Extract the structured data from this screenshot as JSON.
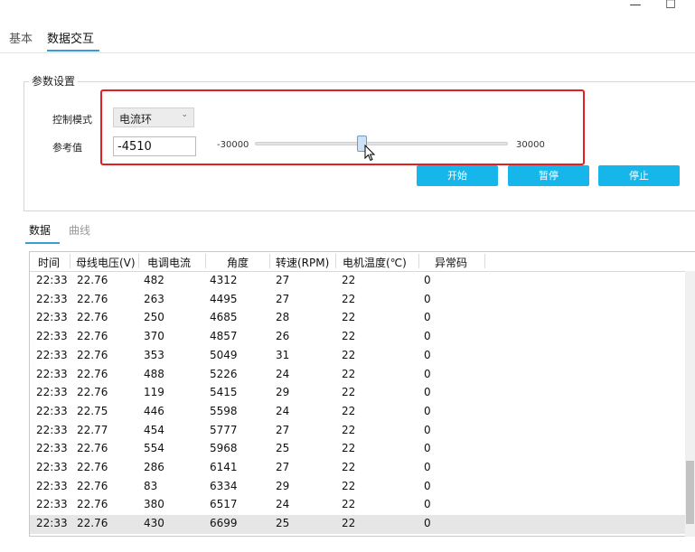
{
  "window": {
    "minimize_icon": "—",
    "maximize_icon": "☐"
  },
  "top_tabs": [
    {
      "label": "基本"
    },
    {
      "label": "数据交互"
    }
  ],
  "params": {
    "title": "参数设置",
    "mode_label": "控制模式",
    "mode_value": "电流环",
    "ref_label": "参考值",
    "ref_value": "-4510",
    "slider_min": "-30000",
    "slider_max": "30000",
    "slider_value": -4510
  },
  "buttons": {
    "start": "开始",
    "pause": "暂停",
    "stop": "停止"
  },
  "data_tabs": [
    {
      "label": "数据"
    },
    {
      "label": "曲线"
    }
  ],
  "table": {
    "columns": [
      "时间",
      "母线电压(V)",
      "电调电流",
      "角度",
      "转速(RPM)",
      "电机温度(℃)",
      "异常码"
    ],
    "rows": [
      [
        "22:33",
        "22.76",
        "482",
        "4312",
        "27",
        "22",
        "0"
      ],
      [
        "22:33",
        "22.76",
        "263",
        "4495",
        "27",
        "22",
        "0"
      ],
      [
        "22:33",
        "22.76",
        "250",
        "4685",
        "28",
        "22",
        "0"
      ],
      [
        "22:33",
        "22.76",
        "370",
        "4857",
        "26",
        "22",
        "0"
      ],
      [
        "22:33",
        "22.76",
        "353",
        "5049",
        "31",
        "22",
        "0"
      ],
      [
        "22:33",
        "22.76",
        "488",
        "5226",
        "24",
        "22",
        "0"
      ],
      [
        "22:33",
        "22.76",
        "119",
        "5415",
        "29",
        "22",
        "0"
      ],
      [
        "22:33",
        "22.75",
        "446",
        "5598",
        "24",
        "22",
        "0"
      ],
      [
        "22:33",
        "22.77",
        "454",
        "5777",
        "27",
        "22",
        "0"
      ],
      [
        "22:33",
        "22.76",
        "554",
        "5968",
        "25",
        "22",
        "0"
      ],
      [
        "22:33",
        "22.76",
        "286",
        "6141",
        "27",
        "22",
        "0"
      ],
      [
        "22:33",
        "22.76",
        "83",
        "6334",
        "29",
        "22",
        "0"
      ],
      [
        "22:33",
        "22.76",
        "380",
        "6517",
        "24",
        "22",
        "0"
      ],
      [
        "22:33",
        "22.76",
        "430",
        "6699",
        "25",
        "22",
        "0"
      ]
    ]
  },
  "colors": {
    "accent": "#17b6ea",
    "highlight_box": "#e31e24",
    "tab_underline": "#3a9bd9"
  }
}
